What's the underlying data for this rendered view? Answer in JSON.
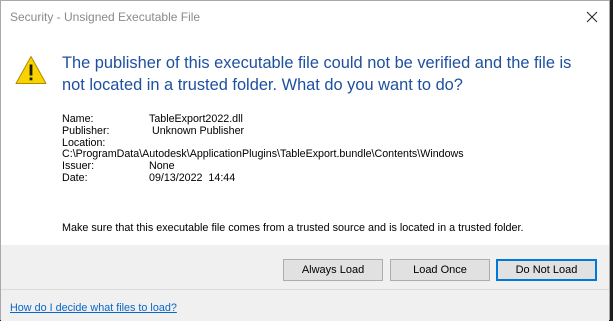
{
  "window": {
    "title": "Security - Unsigned Executable File",
    "close_glyph": "✕"
  },
  "icons": {
    "warning": "warning-triangle-icon",
    "close": "close-icon"
  },
  "message": {
    "headline": "The publisher of this executable file could not be verified and the file is not located in a trusted folder. What do you want to do?"
  },
  "details": {
    "name_label": "Name:",
    "name_value": "TableExport2022.dll",
    "publisher_label": "Publisher:",
    "publisher_value": "Unknown Publisher",
    "location_label": "Location:",
    "location_value": "C:\\ProgramData\\Autodesk\\ApplicationPlugins\\TableExport.bundle\\Contents\\Windows",
    "issuer_label": "Issuer:",
    "issuer_value": "None",
    "date_label": "Date:",
    "date_value": "09/13/2022  14:44"
  },
  "notice": "Make sure that this executable file comes from a trusted source and is located in a trusted folder.",
  "buttons": {
    "always_load": "Always Load",
    "load_once": "Load Once",
    "do_not_load": "Do Not Load"
  },
  "footer": {
    "help_link": "How do I decide what files to load?"
  },
  "colors": {
    "headline": "#1e50a0",
    "link": "#0b66c6",
    "warning_fill": "#f8d300",
    "default_button_border": "#0078d7"
  }
}
